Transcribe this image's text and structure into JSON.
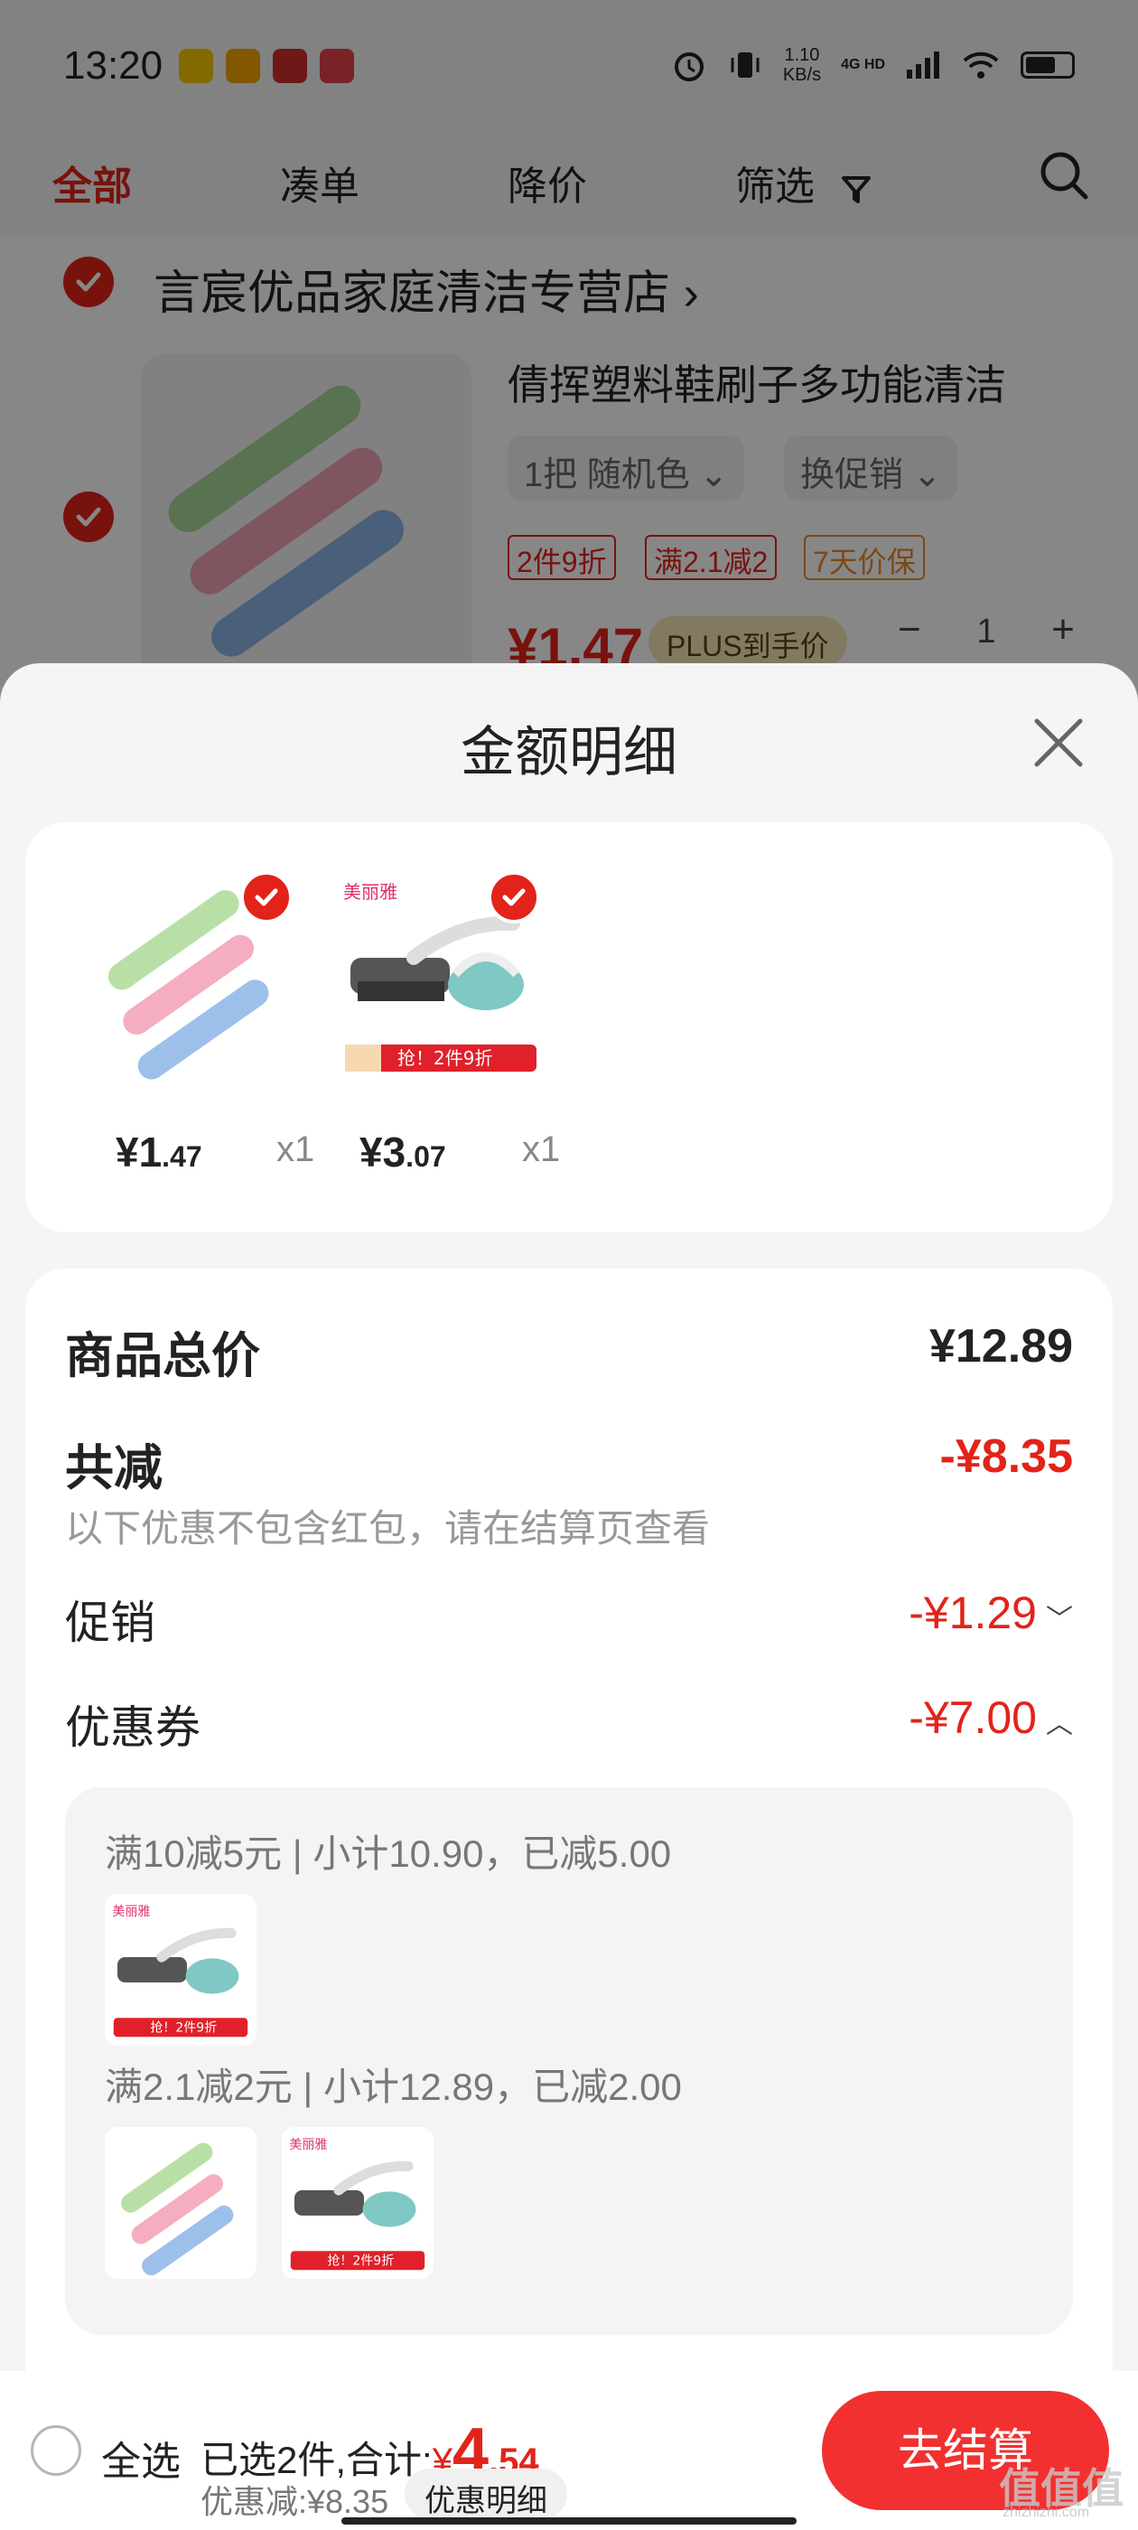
{
  "status_bar": {
    "time": "13:20",
    "net_speed_value": "1.10",
    "net_speed_unit": "KB/s",
    "network": "4G HD"
  },
  "tabs": [
    {
      "label": "全部",
      "active": true
    },
    {
      "label": "凑单",
      "active": false
    },
    {
      "label": "降价",
      "active": false
    },
    {
      "label": "筛选",
      "active": false
    }
  ],
  "cart": {
    "store_name": "言宸优品家庭清洁专营店",
    "product_title": "倩挥塑料鞋刷子多功能清洁",
    "spec": "1把 随机色",
    "change_promo": "换促销",
    "tags": [
      "2件9折",
      "满2.1减2",
      "7天价保"
    ],
    "price": "¥1.47",
    "plus_label": "PLUS到手价",
    "quantity": "1"
  },
  "sheet": {
    "title": "金额明细",
    "items": [
      {
        "price_main": "¥1",
        "price_decimal": ".47",
        "qty": "x1"
      },
      {
        "price_main": "¥3",
        "price_decimal": ".07",
        "qty": "x1"
      }
    ],
    "total_label": "商品总价",
    "total_value": "¥12.89",
    "discount_label": "共减",
    "discount_value": "-¥8.35",
    "discount_note": "以下优惠不包含红包，请在结算页查看",
    "promo_label": "促销",
    "promo_value": "-¥1.29",
    "coupon_label": "优惠券",
    "coupon_value": "-¥7.00",
    "coupons": [
      {
        "text": "满10减5元 | 小计10.90，已减5.00"
      },
      {
        "text": "满2.1减2元 | 小计12.89，已减2.00"
      }
    ],
    "product_image_badge": "抢！2件9折",
    "product_brand": "美丽雅"
  },
  "bottom_bar": {
    "select_all": "全选",
    "selected_prefix": "已选2件,合计:",
    "total_symbol": "¥",
    "total_integer": "4",
    "total_decimal": ".54",
    "discount_text": "优惠减:¥8.35",
    "detail_button": "优惠明细",
    "checkout_button": "去结算"
  },
  "watermark": {
    "text": "值值值",
    "sub": "zhizhizhi.com"
  },
  "colors": {
    "accent": "#e2231a",
    "checkout": "#f23030",
    "sheet_bg": "#f5f5f5"
  }
}
